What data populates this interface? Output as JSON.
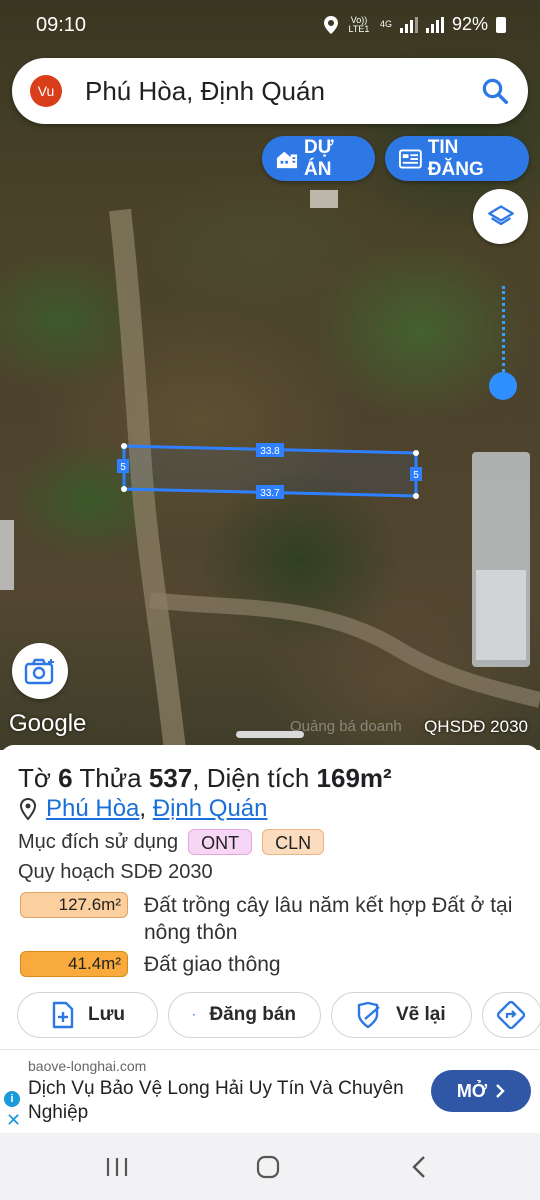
{
  "status_bar": {
    "time": "09:10",
    "volte": "Vo)) LTE1",
    "network": "4G",
    "battery": "92%"
  },
  "search": {
    "avatar_text": "Vu",
    "query": "Phú Hòa, Định Quán"
  },
  "map_buttons": {
    "du_an": "DỰ ÁN",
    "tin_dang": "TIN ĐĂNG"
  },
  "map": {
    "dimension_top": "33.8",
    "dimension_bottom": "33.7",
    "dimension_left": "5",
    "dimension_right": "5",
    "google_logo": "Google",
    "watermark": "Quảng bá doanh",
    "layer_label": "QHSDĐ 2030"
  },
  "parcel": {
    "sheet_label": "Tờ",
    "sheet_number": "6",
    "lot_label": "Thửa",
    "lot_number": "537",
    "area_label": ", Diện tích",
    "area_value": "169m²",
    "ward": "Phú Hòa",
    "district": "Định Quán",
    "purpose_label": "Mục đích sử dụng",
    "purpose_tags": [
      "ONT",
      "CLN"
    ],
    "plan_title": "Quy hoạch SDĐ 2030",
    "plan_items": [
      {
        "area": "127.6m²",
        "description": "Đất trồng cây lâu năm kết hợp Đất ở tại nông thôn"
      },
      {
        "area": "41.4m²",
        "description": "Đất giao thông"
      }
    ]
  },
  "actions": {
    "save": "Lưu",
    "sell": "Đăng bán",
    "redraw": "Vẽ lại"
  },
  "ad": {
    "domain": "baove-longhai.com",
    "text": "Dịch Vụ Bảo Vệ Long Hải Uy Tín Và Chuyên Nghiệp",
    "cta": "MỞ"
  },
  "colors": {
    "accent_blue": "#2e78e6",
    "tag_ont": "#f7d6f5",
    "tag_cln": "#fbdcbe",
    "area_1": "#fbcf9e",
    "area_2": "#f8aa3c",
    "ad_cta": "#2f57a5"
  }
}
